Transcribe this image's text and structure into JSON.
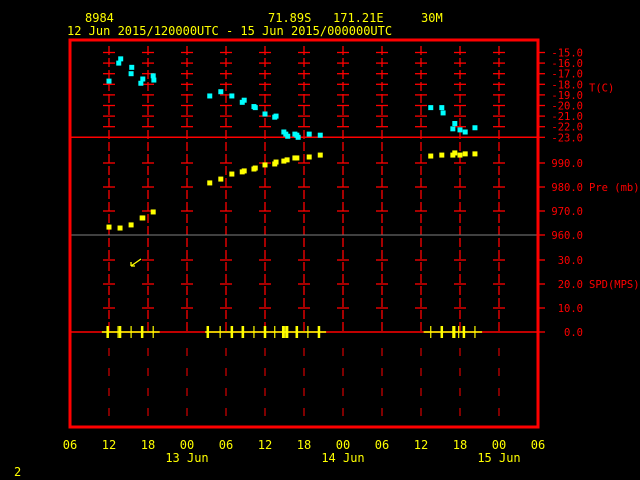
{
  "header": {
    "station_id": "8984",
    "latitude": "71.89S",
    "longitude": "171.21E",
    "elevation": "30M",
    "time_range": "12 Jun 2015/120000UTC - 15 Jun 2015/000000UTC"
  },
  "page_number": "2",
  "colors": {
    "frame": "#ff0000",
    "temperature": "#00ffff",
    "pressure": "#ffff00",
    "wind": "#ffff00",
    "text": "#ffff00",
    "divider_960": "#808080"
  },
  "chart_data": {
    "type": "scatter",
    "title": "8984  71.89S 171.21E 30M  12 Jun 2015/120000UTC - 15 Jun 2015/000000UTC",
    "x_unit": "hours since 12 Jun 06 UTC",
    "xlim": [
      0,
      72
    ],
    "x_ticks": [
      {
        "h": 0,
        "label": "06"
      },
      {
        "h": 6,
        "label": "12"
      },
      {
        "h": 12,
        "label": "18"
      },
      {
        "h": 18,
        "label": "00"
      },
      {
        "h": 24,
        "label": "06"
      },
      {
        "h": 30,
        "label": "12"
      },
      {
        "h": 36,
        "label": "18"
      },
      {
        "h": 42,
        "label": "00"
      },
      {
        "h": 48,
        "label": "06"
      },
      {
        "h": 54,
        "label": "12"
      },
      {
        "h": 60,
        "label": "18"
      },
      {
        "h": 66,
        "label": "00"
      },
      {
        "h": 72,
        "label": "06"
      }
    ],
    "day_labels": [
      {
        "h": 18,
        "label": "13 Jun"
      },
      {
        "h": 42,
        "label": "14 Jun"
      },
      {
        "h": 66,
        "label": "15 Jun"
      }
    ],
    "panels": [
      {
        "name": "temperature",
        "ylabel": "T(C)",
        "ylim": [
          -23,
          -15
        ],
        "ticks": [
          -15,
          -16,
          -17,
          -18,
          -19,
          -20,
          -21,
          -22,
          -23
        ],
        "tick_labels": [
          "-15.0",
          "-16.0",
          "-17.0",
          "-18.0",
          "-19.0",
          "-20.0",
          "-21.0",
          "-22.0",
          "-23.0"
        ],
        "x": [
          6.0,
          7.5,
          7.8,
          9.4,
          9.5,
          10.9,
          11.2,
          12.8,
          12.9,
          21.5,
          23.2,
          24.9,
          26.5,
          26.8,
          28.3,
          28.5,
          30.0,
          31.5,
          31.7,
          32.9,
          33.2,
          33.5,
          34.6,
          34.9,
          35.1,
          36.8,
          38.5,
          55.5,
          57.2,
          57.4,
          58.9,
          59.2,
          60.0,
          60.8,
          62.3
        ],
        "y": [
          -17.7,
          -16.0,
          -15.6,
          -17.0,
          -16.4,
          -17.9,
          -17.5,
          -17.2,
          -17.6,
          -19.1,
          -18.7,
          -19.1,
          -19.7,
          -19.5,
          -20.1,
          -20.2,
          -20.8,
          -21.1,
          -21.0,
          -22.5,
          -22.7,
          -22.9,
          -22.7,
          -22.8,
          -23.0,
          -22.7,
          -22.8,
          -20.2,
          -20.2,
          -20.7,
          -22.2,
          -21.7,
          -22.3,
          -22.5,
          -22.1
        ]
      },
      {
        "name": "pressure",
        "ylabel": "Pre (mb)",
        "ylim": [
          960,
          993
        ],
        "ticks": [
          990,
          980,
          970,
          960
        ],
        "tick_labels": [
          "990.0",
          "980.0",
          "970.0",
          "960.0"
        ],
        "x": [
          6.0,
          7.7,
          9.4,
          11.1,
          11.2,
          12.8,
          21.5,
          23.2,
          24.9,
          26.5,
          26.8,
          28.3,
          28.5,
          30.0,
          31.5,
          31.7,
          32.9,
          33.4,
          34.6,
          34.9,
          36.8,
          38.5,
          55.5,
          57.2,
          58.9,
          59.2,
          60.0,
          60.8,
          62.3
        ],
        "y": [
          963.3,
          962.9,
          964.2,
          967.1,
          967.1,
          969.6,
          981.7,
          983.3,
          985.4,
          986.3,
          986.7,
          987.5,
          987.9,
          989.2,
          989.6,
          990.4,
          990.8,
          991.3,
          992.1,
          992.1,
          992.5,
          993.3,
          992.9,
          993.3,
          993.3,
          994.2,
          993.3,
          993.8,
          993.8
        ]
      },
      {
        "name": "wind_speed",
        "ylabel": "SPD(MPS)",
        "ylim": [
          0,
          35
        ],
        "ticks": [
          30,
          20,
          10,
          0
        ],
        "tick_labels": [
          "30.0",
          "20.0",
          "10.0",
          "0.0"
        ],
        "x": [
          5.8,
          7.4,
          7.7,
          9.4,
          11.1,
          12.8,
          21.2,
          23.1,
          24.9,
          26.5,
          26.6,
          28.3,
          30.0,
          31.5,
          32.8,
          33.1,
          33.4,
          34.8,
          34.9,
          36.6,
          38.3,
          55.5,
          57.2,
          58.9,
          59.1,
          59.8,
          60.6,
          62.3
        ],
        "y": [
          0,
          0,
          0,
          0,
          0,
          0,
          0,
          0,
          0,
          0,
          0,
          0,
          0,
          0,
          0,
          0,
          0,
          0,
          0,
          0,
          0,
          0,
          0,
          0,
          0,
          0,
          0,
          0
        ],
        "bar_spans": [
          [
            4.9,
            13.8
          ],
          [
            20.8,
            39.4
          ],
          [
            54.4,
            63.4
          ]
        ]
      }
    ]
  }
}
